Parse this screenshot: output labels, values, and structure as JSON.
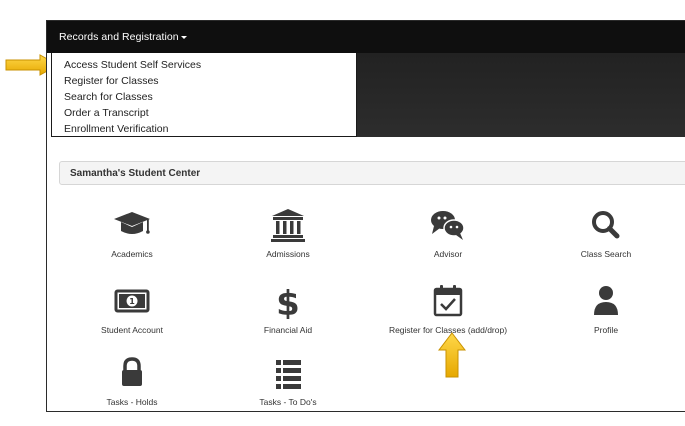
{
  "topbar": {
    "menu_label": "Records and Registration"
  },
  "dropdown": {
    "items": [
      "Access Student Self Services",
      "Register for Classes",
      "Search for Classes",
      "Order a Transcript",
      "Enrollment Verification"
    ]
  },
  "student_center": {
    "title": "Samantha's Student Center",
    "tiles": [
      {
        "label": "Academics",
        "icon": "graduation-cap-icon"
      },
      {
        "label": "Admissions",
        "icon": "institution-icon"
      },
      {
        "label": "Advisor",
        "icon": "chat-bubbles-icon"
      },
      {
        "label": "Class Search",
        "icon": "search-icon"
      },
      {
        "label": "Student Account",
        "icon": "money-bill-icon"
      },
      {
        "label": "Financial Aid",
        "icon": "dollar-sign-icon"
      },
      {
        "label": "Register for Classes (add/drop)",
        "icon": "calendar-check-icon"
      },
      {
        "label": "Profile",
        "icon": "user-icon"
      },
      {
        "label": "Tasks - Holds",
        "icon": "lock-icon"
      },
      {
        "label": "Tasks - To Do's",
        "icon": "list-icon"
      }
    ]
  },
  "colors": {
    "topbar": "#0f0f0f",
    "icon": "#3a3a3a",
    "highlight_arrow": "#f2c21b"
  }
}
